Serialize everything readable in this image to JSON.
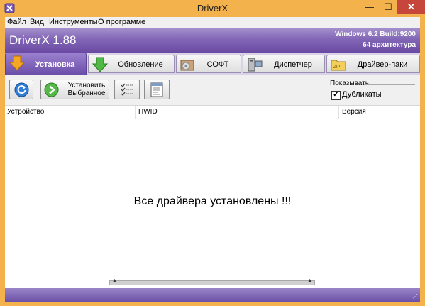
{
  "window": {
    "title": "DriverX",
    "min_glyph": "—",
    "max_glyph": "☐",
    "close_glyph": "✕"
  },
  "menu": {
    "items": [
      "Файл",
      "Вид",
      "Инструменты",
      "О программе"
    ]
  },
  "banner": {
    "app_title": "DriverX 1.88",
    "os_info": "Windows 6.2  Build:9200",
    "arch_info": "64 архитектура"
  },
  "tabs": [
    {
      "label": "Установка",
      "icon": "download-arrow-icon",
      "active": true
    },
    {
      "label": "Обновление",
      "icon": "green-arrow-icon",
      "active": false
    },
    {
      "label": "СОФТ",
      "icon": "software-box-icon",
      "active": false
    },
    {
      "label": "Диспетчер",
      "icon": "computer-icon",
      "active": false
    },
    {
      "label": "Драйвер-паки",
      "icon": "zip-folder-icon",
      "active": false
    }
  ],
  "toolbar": {
    "refresh_icon": "refresh-icon",
    "install_label_line1": "Установить",
    "install_label_line2": "Выбранное",
    "checklist_icon": "checklist-icon",
    "document_icon": "document-icon"
  },
  "show_group": {
    "label": "Показывать",
    "duplicates_label": "Дубликаты",
    "duplicates_checked": true
  },
  "columns": [
    "Устройство",
    "HWID",
    "Версия"
  ],
  "message": "Все драйвера установлены !!!",
  "colors": {
    "accent": "#6b4ea9",
    "title_bar": "#f3b24c",
    "close_button": "#c7463c"
  }
}
